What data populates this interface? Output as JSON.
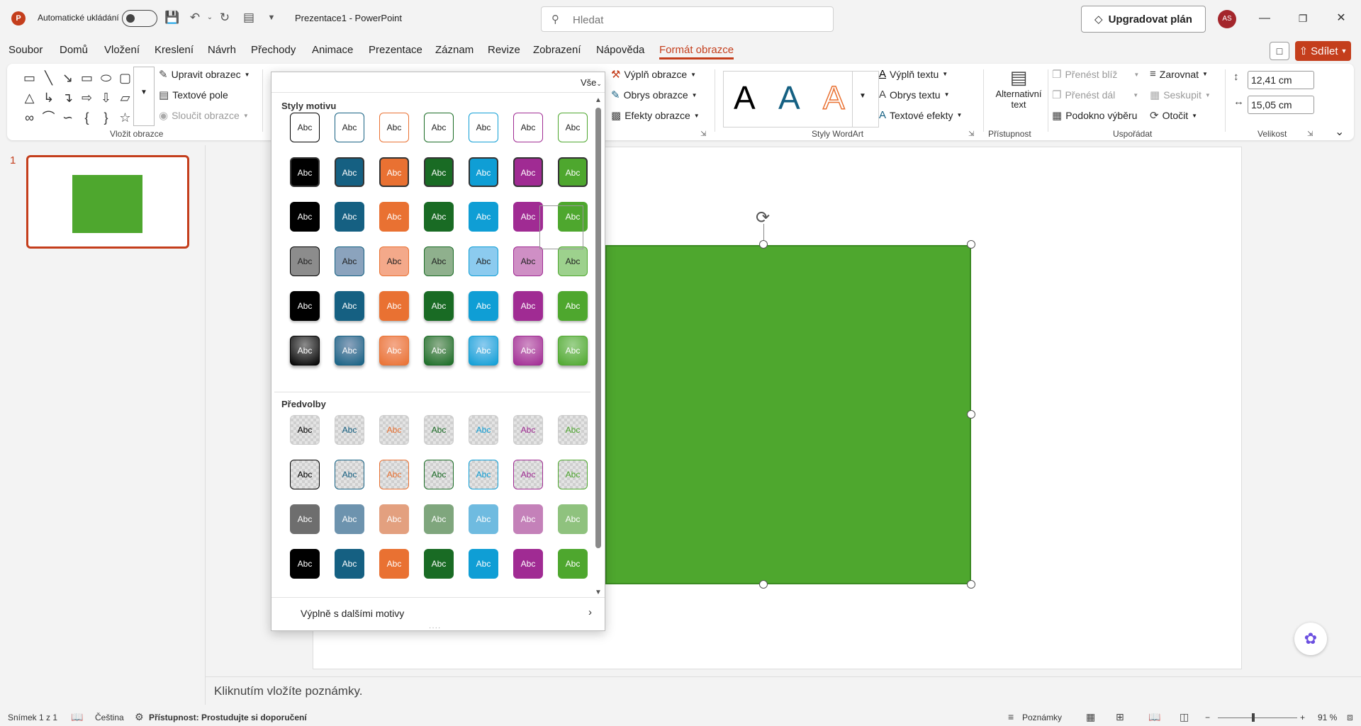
{
  "titlebar": {
    "app_logo": "P",
    "autosave_label": "Automatické ukládání",
    "doc_title": "Prezentace1  -  PowerPoint",
    "search_placeholder": "Hledat",
    "upgrade_label": "Upgradovat plán",
    "avatar_initials": "AS"
  },
  "menu": {
    "items": [
      "Soubor",
      "Domů",
      "Vložení",
      "Kreslení",
      "Návrh",
      "Přechody",
      "Animace",
      "Prezentace",
      "Záznam",
      "Revize",
      "Zobrazení",
      "Nápověda",
      "Formát obrazce"
    ],
    "active": "Formát obrazce",
    "share_label": "Sdílet"
  },
  "ribbon": {
    "insert_shapes": {
      "edit_shape": "Upravit obrazec",
      "text_box": "Textové pole",
      "merge_shapes": "Sloučit obrazce",
      "group_label": "Vložit obrazce"
    },
    "shape_styles": {
      "fill": "Výplň obrazce",
      "outline": "Obrys obrazce",
      "effects": "Efekty obrazce"
    },
    "wordart": {
      "text_fill": "Výplň textu",
      "text_outline": "Obrys textu",
      "text_effects": "Textové efekty",
      "group_label": "Styly WordArt",
      "samples": [
        "A",
        "A",
        "A"
      ]
    },
    "accessibility": {
      "alt_text_line1": "Alternativní",
      "alt_text_line2": "text",
      "group_label": "Přístupnost"
    },
    "arrange": {
      "bring_forward": "Přenést blíž",
      "send_backward": "Přenést dál",
      "selection_pane": "Podokno výběru",
      "align": "Zarovnat",
      "group": "Seskupit",
      "rotate": "Otočit",
      "group_label": "Uspořádat"
    },
    "size": {
      "height": "12,41 cm",
      "width": "15,05 cm",
      "group_label": "Velikost"
    }
  },
  "gallery": {
    "filter_label": "Vše",
    "theme_styles_title": "Styly motivu",
    "presets_title": "Předvolby",
    "sample_text": "Abc",
    "accent_colors": [
      "#000000",
      "#156082",
      "#e97132",
      "#196b24",
      "#0f9ed5",
      "#a02b93",
      "#4ea72e"
    ],
    "light_tints": [
      "#8c8c8c",
      "#8ba3bd",
      "#f4a98a",
      "#8fb08d",
      "#8ccbef",
      "#cf8fc5",
      "#9dd18d"
    ],
    "preset_muted": [
      "#6e6e6e",
      "#6d93ae",
      "#e3a07f",
      "#7fa67d",
      "#6fbbe0",
      "#c481b9",
      "#8fc27e"
    ],
    "more_fills_label": "Výplně s dalšími motivy"
  },
  "slides": {
    "slide_number": "1"
  },
  "notes_placeholder": "Kliknutím vložíte poznámky.",
  "statusbar": {
    "slide_info": "Snímek 1 z 1",
    "language": "Čeština",
    "accessibility": "Přístupnost: Prostudujte si doporučení",
    "notes": "Poznámky",
    "zoom": "91 %"
  },
  "colors": {
    "accent": "#c43e1c",
    "shape_fill": "#4ea72e"
  }
}
